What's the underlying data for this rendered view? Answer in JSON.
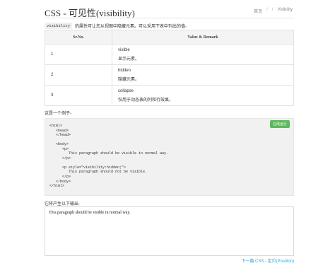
{
  "header": {
    "title": "CSS - 可见性(visibility)",
    "breadcrumb": [
      "首页",
      "/",
      "/",
      "Visibility"
    ]
  },
  "intro": {
    "code": "visibility",
    "text": "的属性可让您从视图中隐藏元素。可以采用下表中列出的值-"
  },
  "table": {
    "columns": [
      "Sr.No.",
      "Value & Remark"
    ],
    "rows": [
      {
        "num": "1",
        "value": "visible",
        "remark": "显示元素。"
      },
      {
        "num": "2",
        "value": "hidden",
        "remark": "隐藏元素。"
      },
      {
        "num": "3",
        "value": "collapse",
        "remark": "仅用于动态表的列和行效果。"
      }
    ]
  },
  "example": {
    "heading": "这是一个例子-",
    "run_label": "在线运行",
    "code": "<html>\n   <head>\n   </head>\n\n   <body>\n      <p>\n         This paragraph should be visible in normal way.\n      </p>\n\n      <p style=\"visibility:hidden;\">\n         This paragraph should not be visible.\n      </p>\n   </body>\n</html>"
  },
  "result": {
    "heading": "它将产生以下输出-",
    "output_text": "This paragraph should be visible in normal way."
  },
  "nav": {
    "next_label": "下一篇 CSS - 定位(Position)"
  }
}
